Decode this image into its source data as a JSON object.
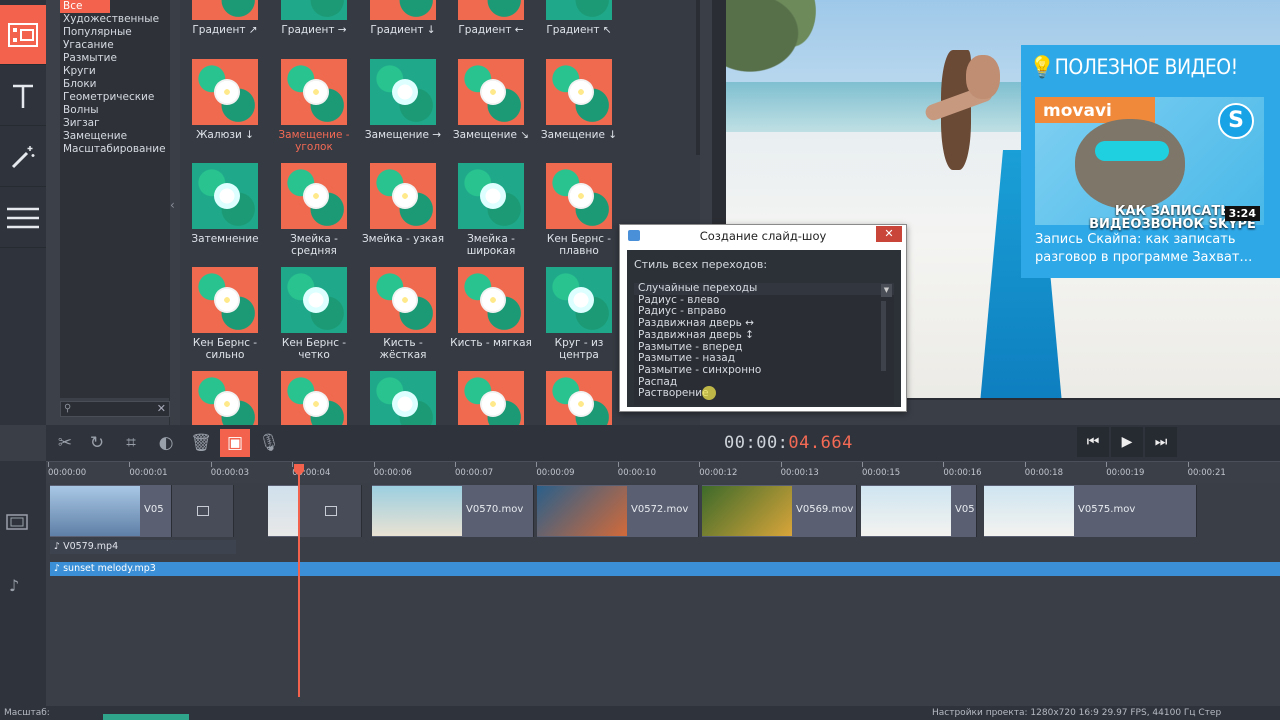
{
  "categories": [
    "Все",
    "Художественные",
    "Популярные",
    "Угасание",
    "Размытие",
    "Круги",
    "Блоки",
    "Геометрические",
    "Волны",
    "Зигзаг",
    "Замещение",
    "Масштабирование"
  ],
  "transitions": [
    {
      "label": "Градиент ↗"
    },
    {
      "label": "Градиент →"
    },
    {
      "label": "Градиент ↓"
    },
    {
      "label": "Градиент ←"
    },
    {
      "label": "Градиент ↖"
    },
    {
      "label": "Жалюзи ↓"
    },
    {
      "label": "Замещение - уголок",
      "highlight": true
    },
    {
      "label": "Замещение →"
    },
    {
      "label": "Замещение ↘"
    },
    {
      "label": "Замещение ↓"
    },
    {
      "label": "Затемнение"
    },
    {
      "label": "Змейка - средняя"
    },
    {
      "label": "Змейка - узкая"
    },
    {
      "label": "Змейка - широкая"
    },
    {
      "label": "Кен Бернс - плавно"
    },
    {
      "label": "Кен Бернс - сильно"
    },
    {
      "label": "Кен Бернс - четко"
    },
    {
      "label": "Кисть - жёсткая"
    },
    {
      "label": "Кисть - мягкая"
    },
    {
      "label": "Круг - из центра"
    },
    {
      "label": ""
    },
    {
      "label": ""
    },
    {
      "label": ""
    },
    {
      "label": ""
    },
    {
      "label": ""
    }
  ],
  "ad": {
    "title": "ПОЛЕЗНОЕ ВИДЕО!",
    "logo": "movavi",
    "overlay_line1": "КАК ЗАПИСАТЬ",
    "overlay_line2": "ВИДЕОЗВОНОК SKYPE",
    "duration": "3:24",
    "caption_line1": "Запись Скайпа: как записать",
    "caption_line2": "разговор в программе Захват…"
  },
  "dialog": {
    "title": "Создание слайд-шоу",
    "close": "✕",
    "label": "Стиль всех переходов:",
    "options": [
      "Случайные переходы",
      "Радиус - влево",
      "Радиус - вправо",
      "Раздвижная дверь ↔",
      "Раздвижная дверь ↕",
      "Размытие - вперед",
      "Размытие - назад",
      "Размытие - синхронно",
      "Распад",
      "Растворение"
    ]
  },
  "timecode": {
    "main": "00:00:",
    "accent": "04.664"
  },
  "ruler": [
    "00:00:00",
    "00:00:01",
    "00:00:03",
    "00:00:04",
    "00:00:06",
    "00:00:07",
    "00:00:09",
    "00:00:10",
    "00:00:12",
    "00:00:13",
    "00:00:15",
    "00:00:16",
    "00:00:18",
    "00:00:19",
    "00:00:21"
  ],
  "clips": [
    "V05",
    "V0570.mov",
    "V0572.mov",
    "V0569.mov",
    "V05",
    "V0575.mov"
  ],
  "audio_clip": "V0579.mp4",
  "music_clip": "sunset melody.mp3",
  "status": {
    "left": "Масштаб:",
    "right": "Настройки проекта:   1280x720 16:9 29.97 FPS, 44100 Гц Стер"
  },
  "colors": {
    "accent": "#f2624c",
    "music": "#3a8fd6",
    "ad_bg": "#2fa8e8"
  }
}
